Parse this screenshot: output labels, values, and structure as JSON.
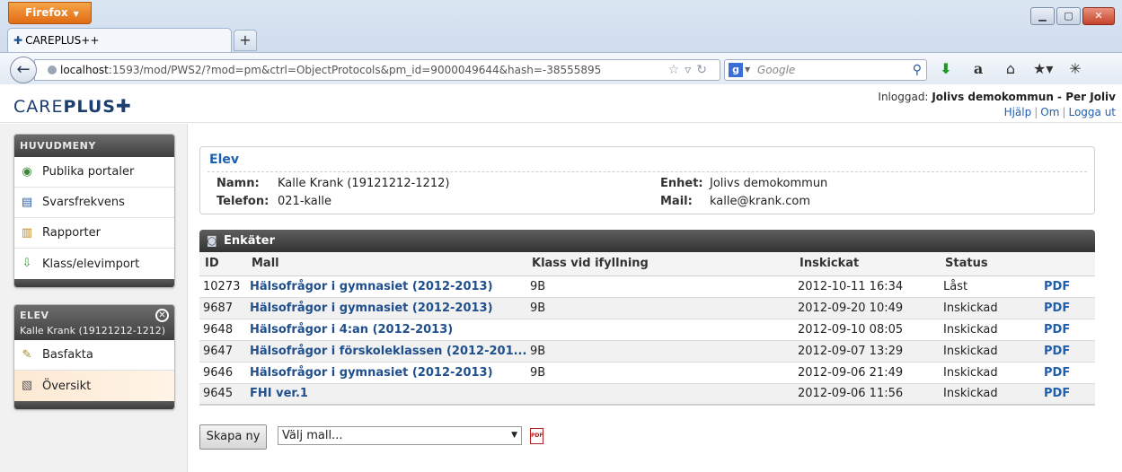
{
  "browser": {
    "app_button": "Firefox",
    "tab_title": "CAREPLUS++",
    "url_host": "localhost",
    "url_rest": ":1593/mod/PWS2/?mod=pm&ctrl=ObjectProtocols&pm_id=9000049644&hash=-38555895",
    "search_placeholder": "Google"
  },
  "header": {
    "brand_light": "CARE",
    "brand_bold": "PLUS",
    "login_prefix": "Inloggad:",
    "login_user": "Jolivs demokommun - Per Joliv",
    "links": [
      "Hjälp",
      "Om",
      "Logga ut"
    ]
  },
  "sidebar": {
    "main_title": "HUVUDMENY",
    "main_items": [
      {
        "label": "Publika portaler",
        "icon": "portal-icon"
      },
      {
        "label": "Svarsfrekvens",
        "icon": "document-icon"
      },
      {
        "label": "Rapporter",
        "icon": "chart-icon"
      },
      {
        "label": "Klass/elevimport",
        "icon": "import-icon"
      }
    ],
    "elev_title": "ELEV",
    "elev_sub": "Kalle Krank (19121212-1212)",
    "elev_items": [
      {
        "label": "Basfakta",
        "icon": "brush-icon"
      },
      {
        "label": "Översikt",
        "icon": "overview-icon"
      }
    ]
  },
  "elev_panel": {
    "title": "Elev",
    "namn_label": "Namn:",
    "namn_value": "Kalle Krank (19121212-1212)",
    "telefon_label": "Telefon:",
    "telefon_value": "021-kalle",
    "enhet_label": "Enhet:",
    "enhet_value": "Jolivs demokommun",
    "mail_label": "Mail:",
    "mail_value": "kalle@krank.com"
  },
  "enkater": {
    "title": "Enkäter",
    "columns": [
      "ID",
      "Mall",
      "Klass vid ifyllning",
      "Inskickat",
      "Status",
      ""
    ],
    "rows": [
      {
        "id": "10273",
        "mall": "Hälsofrågor i gymnasiet (2012-2013)",
        "klass": "9B",
        "inskickat": "2012-10-11 16:34",
        "status": "Låst",
        "pdf": "PDF"
      },
      {
        "id": "9687",
        "mall": "Hälsofrågor i gymnasiet (2012-2013)",
        "klass": "9B",
        "inskickat": "2012-09-20 10:49",
        "status": "Inskickad",
        "pdf": "PDF"
      },
      {
        "id": "9648",
        "mall": "Hälsofrågor i 4:an (2012-2013)",
        "klass": "",
        "inskickat": "2012-09-10 08:05",
        "status": "Inskickad",
        "pdf": "PDF"
      },
      {
        "id": "9647",
        "mall": "Hälsofrågor i förskoleklassen (2012-201...",
        "klass": "9B",
        "inskickat": "2012-09-07 13:29",
        "status": "Inskickad",
        "pdf": "PDF"
      },
      {
        "id": "9646",
        "mall": "Hälsofrågor i gymnasiet (2012-2013)",
        "klass": "9B",
        "inskickat": "2012-09-06 21:49",
        "status": "Inskickad",
        "pdf": "PDF"
      },
      {
        "id": "9645",
        "mall": "FHI ver.1",
        "klass": "",
        "inskickat": "2012-09-06 11:56",
        "status": "Inskickad",
        "pdf": "PDF"
      }
    ],
    "create_button": "Skapa ny",
    "select_value": "Välj mall...",
    "pdf_icon_text": "PDF"
  }
}
